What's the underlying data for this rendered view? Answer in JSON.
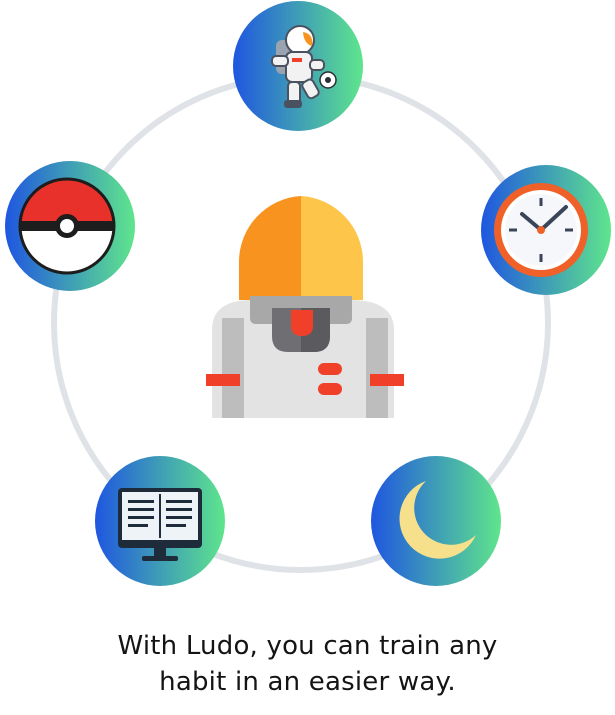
{
  "onboarding": {
    "caption_line_1": "With Ludo, you can train any",
    "caption_line_2": "habit in an easier way.",
    "central_icon": "astronaut-icon",
    "habit_icons": [
      "astronaut-soccer-icon",
      "clock-icon",
      "moon-icon",
      "ebook-icon",
      "pokeball-icon"
    ]
  },
  "colors": {
    "ring": "#dfe2e7",
    "gradient_start": "#1f56e0",
    "gradient_end": "#5fe58c",
    "helmet_left": "#f7931e",
    "helmet_right": "#fdc54a",
    "suit": "#e3e3e3",
    "suit_shadow": "#a8a8a8",
    "accent_red": "#f0402a"
  }
}
